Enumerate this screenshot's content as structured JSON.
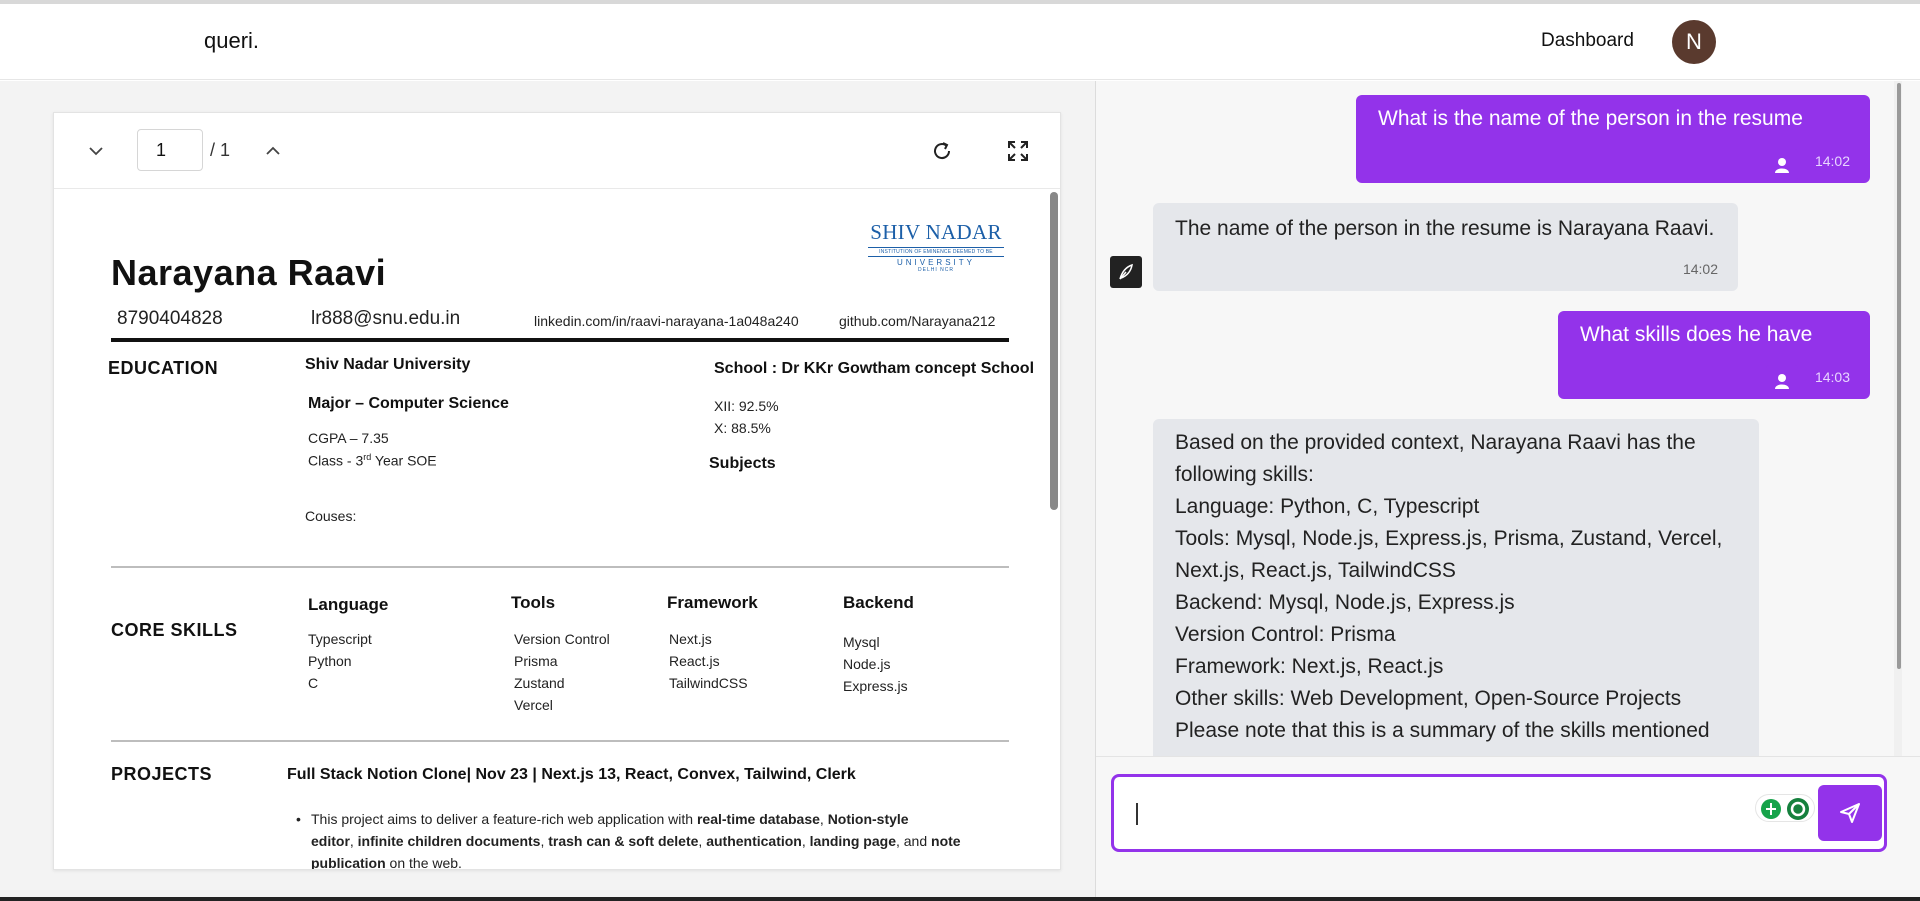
{
  "app": {
    "logo": "queri.",
    "nav_dashboard": "Dashboard",
    "avatar_initial": "N"
  },
  "viewer": {
    "page_current": "1",
    "page_total": "/ 1"
  },
  "resume": {
    "name": "Narayana Raavi",
    "phone": "8790404828",
    "email": "lr888@snu.edu.in",
    "linkedin": "linkedin.com/in/raavi-narayana-1a048a240",
    "github": "github.com/Narayana212",
    "logo": {
      "main": "SHIV NADAR",
      "sub": "INSTITUTION OF EMINENCE DEEMED TO BE",
      "uni": "UNIVERSITY",
      "loc": "DELHI NCR"
    },
    "education": {
      "title": "EDUCATION",
      "university": "Shiv Nadar University",
      "major": "Major – Computer Science",
      "cgpa": "CGPA – 7.35",
      "class_prefix": "Class  - 3",
      "class_sup": "rd",
      "class_suffix": " Year SOE",
      "courses": "Couses:",
      "school": "School : Dr KKr Gowtham concept School",
      "xii": "XII: 92.5%",
      "x": "X: 88.5%",
      "subjects": "Subjects"
    },
    "skills": {
      "title": "CORE SKILLS",
      "columns": [
        {
          "head": "Language",
          "items": [
            "Typescript",
            "Python",
            "C"
          ]
        },
        {
          "head": "Tools",
          "items": [
            "Version Control",
            "Prisma",
            "Zustand",
            "Vercel"
          ]
        },
        {
          "head": "Framework",
          "items": [
            "Next.js",
            "React.js",
            "TailwindCSS"
          ]
        },
        {
          "head": "Backend",
          "items": [
            "Mysql",
            "Node.js",
            "Express.js"
          ]
        }
      ]
    },
    "projects": {
      "title": "PROJECTS",
      "project_title": "Full Stack Notion Clone| Nov 23 | Next.js 13, React, Convex, Tailwind, Clerk",
      "bullet_line1_a": "This project aims to deliver a feature-rich web application with ",
      "bullet_line1_b": "real-time database",
      "bullet_line1_c": ", ",
      "bullet_line1_d": "Notion-style",
      "bullet_line2_a": "editor",
      "bullet_line2_b": ", ",
      "bullet_line2_c": "infinite children documents",
      "bullet_line2_d": ", ",
      "bullet_line2_e": "trash can & soft delete",
      "bullet_line2_f": ", ",
      "bullet_line2_g": "authentication",
      "bullet_line2_h": ", ",
      "bullet_line2_i": "landing page",
      "bullet_line2_j": ", and ",
      "bullet_line2_k": "note",
      "bullet_line3_a": "publication",
      "bullet_line3_b": " on the web."
    }
  },
  "chat": {
    "messages": [
      {
        "role": "user",
        "text": "What is the name of the person in the resume",
        "time": "14:02"
      },
      {
        "role": "bot",
        "text": "The name of the person in the resume is Narayana Raavi.",
        "time": "14:02"
      },
      {
        "role": "user",
        "text": "What skills does he have",
        "time": "14:03"
      },
      {
        "role": "bot",
        "lines": [
          "Based on the provided context, Narayana Raavi has the",
          "following skills:",
          "Language: Python, C, Typescript",
          "Tools: Mysql, Node.js, Express.js, Prisma, Zustand, Vercel,",
          "Next.js, React.js, TailwindCSS",
          "Backend: Mysql, Node.js, Express.js",
          "Version Control: Prisma",
          "Framework: Next.js, React.js",
          "Other skills: Web Development, Open-Source Projects",
          "Please note that this is a summary of the skills mentioned"
        ]
      }
    ],
    "input_value": "",
    "colors": {
      "accent": "#9333ea",
      "bot_bubble": "#e5e7eb"
    }
  }
}
